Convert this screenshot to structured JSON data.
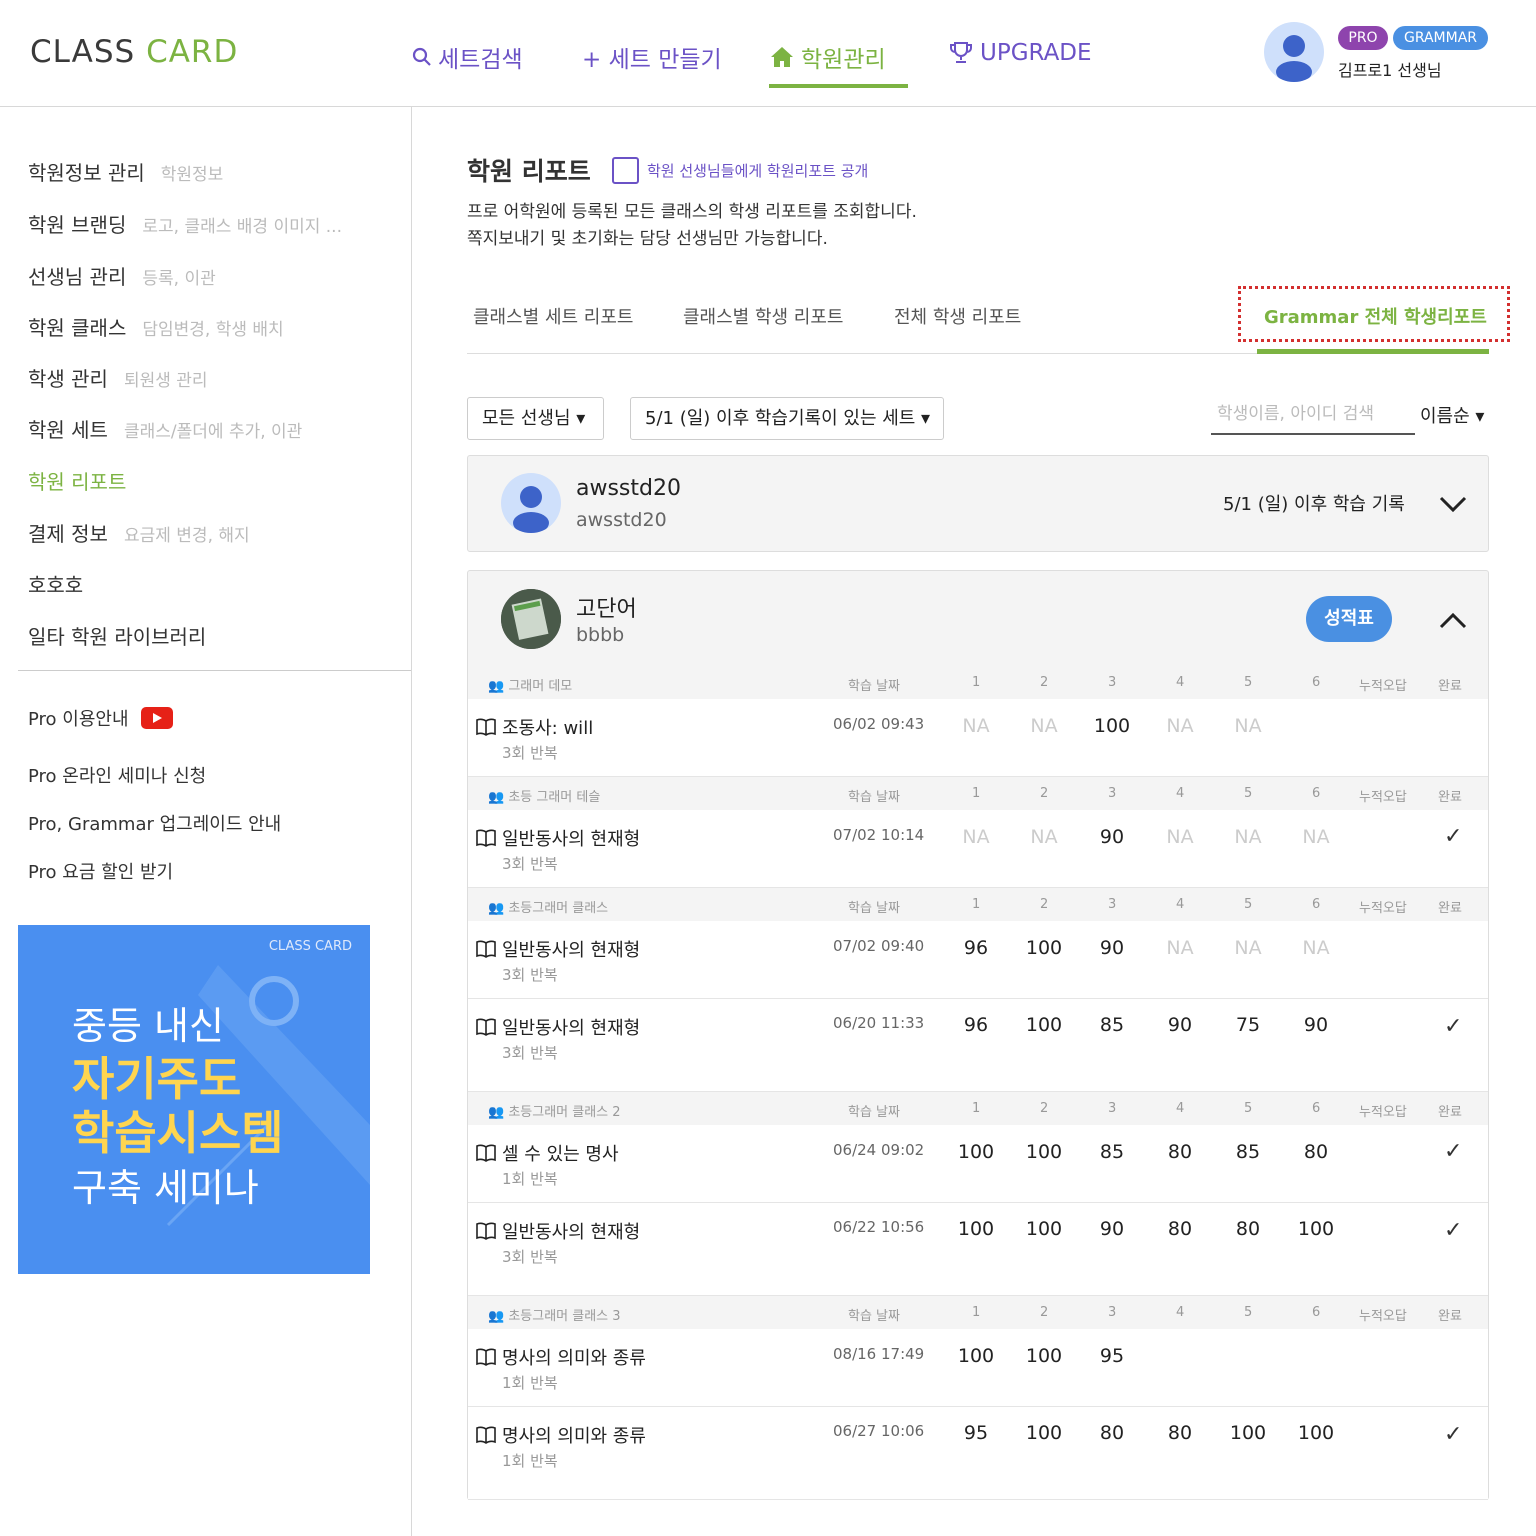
{
  "header": {
    "logo_part1": "CLASS",
    "logo_part2": "CARD",
    "nav": [
      "세트검색",
      "+ 세트 만들기",
      "학원관리",
      "UPGRADE"
    ],
    "badge_pro": "PRO",
    "badge_grammar": "GRAMMAR",
    "user": "김프로1 선생님",
    "accent": "#7cb342",
    "purple": "#6b52c6"
  },
  "sidebar": {
    "items": [
      {
        "label": "학원정보 관리",
        "sub": "학원정보"
      },
      {
        "label": "학원 브랜딩",
        "sub": "로고, 클래스 배경 이미지 ..."
      },
      {
        "label": "선생님 관리",
        "sub": "등록, 이관"
      },
      {
        "label": "학원 클래스",
        "sub": "담임변경, 학생 배치"
      },
      {
        "label": "학생 관리",
        "sub": "퇴원생 관리"
      },
      {
        "label": "학원 세트",
        "sub": "클래스/폴더에 추가, 이관"
      },
      {
        "label": "학원 리포트",
        "sub": ""
      },
      {
        "label": "결제 정보",
        "sub": "요금제 변경, 해지"
      },
      {
        "label": "호호호",
        "sub": ""
      },
      {
        "label": "일타 학원 라이브러리",
        "sub": ""
      }
    ],
    "pro": [
      "Pro 이용안내",
      "Pro 온라인 세미나 신청",
      "Pro, Grammar 업그레이드 안내",
      "Pro 요금 할인 받기"
    ],
    "banner": {
      "logo": "CLASS CARD",
      "l1": "중등 내신",
      "l2": "자기주도",
      "l3": "학습시스템",
      "l4": "구축 세미나"
    }
  },
  "main": {
    "title": "학원 리포트",
    "share": "학원 선생님들에게 학원리포트 공개",
    "desc1": "프로 어학원에 등록된 모든 클래스의 학생 리포트를 조회합니다.",
    "desc2": "쪽지보내기 및 초기화는 담당 선생님만 가능합니다.",
    "tabs": [
      "클래스별 세트 리포트",
      "클래스별 학생 리포트",
      "전체 학생 리포트",
      "Grammar 전체 학생리포트"
    ],
    "filter_teacher": "모든 선생님 ▾",
    "filter_set": "5/1 (일) 이후 학습기록이 있는 세트 ▾",
    "search_placeholder": "학생이름, 아이디 검색",
    "sort": "이름순 ▾",
    "student1": {
      "name": "awsstd20",
      "id": "awsstd20",
      "record": "5/1 (일) 이후 학습 기록"
    },
    "student2": {
      "name": "고단어",
      "id": "bbbb",
      "btn": "성적표"
    },
    "cols": {
      "date": "학습 날짜",
      "nums": [
        "1",
        "2",
        "3",
        "4",
        "5",
        "6"
      ],
      "wrong": "누적오답",
      "done": "완료"
    },
    "groups": [
      {
        "name": "그래머 데모",
        "rows": [
          {
            "title": "조동사: will",
            "rep": "3회 반복",
            "date": "06/02 09:43",
            "scores": [
              "NA",
              "NA",
              "100",
              "NA",
              "NA",
              ""
            ],
            "done": ""
          }
        ]
      },
      {
        "name": "초등 그래머 테슬",
        "rows": [
          {
            "title": "일반동사의 현재형",
            "rep": "3회 반복",
            "date": "07/02 10:14",
            "scores": [
              "NA",
              "NA",
              "90",
              "NA",
              "NA",
              "NA"
            ],
            "done": "✓"
          }
        ]
      },
      {
        "name": "초등그래머 클래스",
        "rows": [
          {
            "title": "일반동사의 현재형",
            "rep": "3회 반복",
            "date": "07/02 09:40",
            "scores": [
              "96",
              "100",
              "90",
              "NA",
              "NA",
              "NA"
            ],
            "done": ""
          },
          {
            "title": "일반동사의 현재형",
            "rep": "3회 반복",
            "date": "06/20 11:33",
            "scores": [
              "96",
              "100",
              "85",
              "90",
              "75",
              "90"
            ],
            "done": "✓"
          }
        ]
      },
      {
        "name": "초등그래머 클래스 2",
        "rows": [
          {
            "title": "셀 수 있는 명사",
            "rep": "1회 반복",
            "date": "06/24 09:02",
            "scores": [
              "100",
              "100",
              "85",
              "80",
              "85",
              "80"
            ],
            "done": "✓"
          },
          {
            "title": "일반동사의 현재형",
            "rep": "3회 반복",
            "date": "06/22 10:56",
            "scores": [
              "100",
              "100",
              "90",
              "80",
              "80",
              "100"
            ],
            "done": "✓"
          }
        ]
      },
      {
        "name": "초등그래머 클래스 3",
        "rows": [
          {
            "title": "명사의 의미와 종류",
            "rep": "1회 반복",
            "date": "08/16 17:49",
            "scores": [
              "100",
              "100",
              "95",
              "",
              "",
              ""
            ],
            "done": ""
          },
          {
            "title": "명사의 의미와 종류",
            "rep": "1회 반복",
            "date": "06/27 10:06",
            "scores": [
              "95",
              "100",
              "80",
              "80",
              "100",
              "100"
            ],
            "done": "✓"
          }
        ]
      }
    ]
  }
}
